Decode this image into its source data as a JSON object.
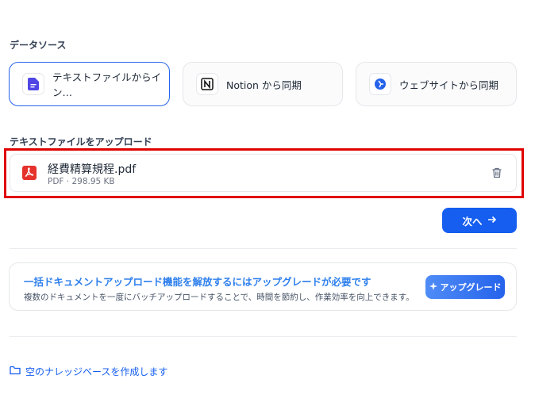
{
  "data_source": {
    "label": "データソース",
    "options": [
      {
        "label": "テキストファイルからイン…",
        "icon": "document-icon",
        "selected": true
      },
      {
        "label": "Notion から同期",
        "icon": "notion-icon",
        "selected": false
      },
      {
        "label": "ウェブサイトから同期",
        "icon": "website-icon",
        "selected": false
      }
    ]
  },
  "upload": {
    "label": "テキストファイルをアップロード",
    "file": {
      "name": "経費精算規程.pdf",
      "meta": "PDF · 298.95 KB",
      "icon": "pdf-icon"
    }
  },
  "next_button": {
    "label": "次へ",
    "icon": "arrow-right-icon"
  },
  "upgrade": {
    "title": "一括ドキュメントアップロード機能を解放するにはアップグレードが必要です",
    "description": "複数のドキュメントを一度にバッチアップロードすることで、時間を節約し、作業効率を向上できます。",
    "button_label": "アップグレード",
    "button_icon": "sparkle-icon"
  },
  "create_empty": {
    "label": "空のナレッジベースを作成します",
    "icon": "folder-icon"
  },
  "colors": {
    "accent": "#155eef",
    "highlight_frame": "#e00000",
    "pdf_red": "#e5322d",
    "upgrade_title": "#2f80ed"
  }
}
